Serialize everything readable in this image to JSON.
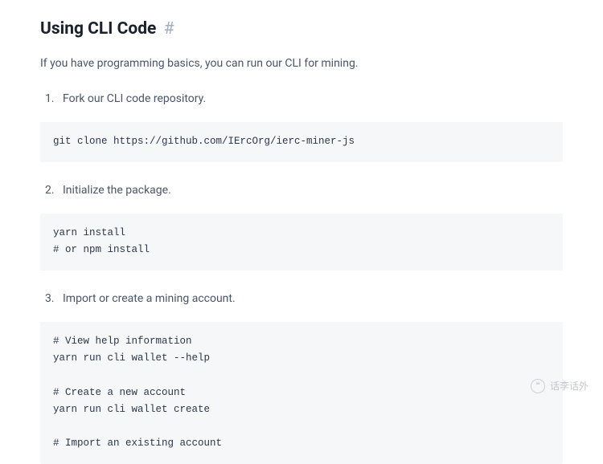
{
  "heading": {
    "title": "Using CLI Code",
    "anchor": "#"
  },
  "intro": "If you have programming basics, you can run our CLI for mining.",
  "steps": [
    "Fork our CLI code repository.",
    "Initialize the package.",
    "Import or create a mining account."
  ],
  "codeblocks": [
    "git clone https://github.com/IErcOrg/ierc-miner-js",
    "yarn install\n# or npm install",
    "# View help information\nyarn run cli wallet --help\n\n# Create a new account\nyarn run cli wallet create\n\n# Import an existing account"
  ],
  "watermark": "话李话外"
}
